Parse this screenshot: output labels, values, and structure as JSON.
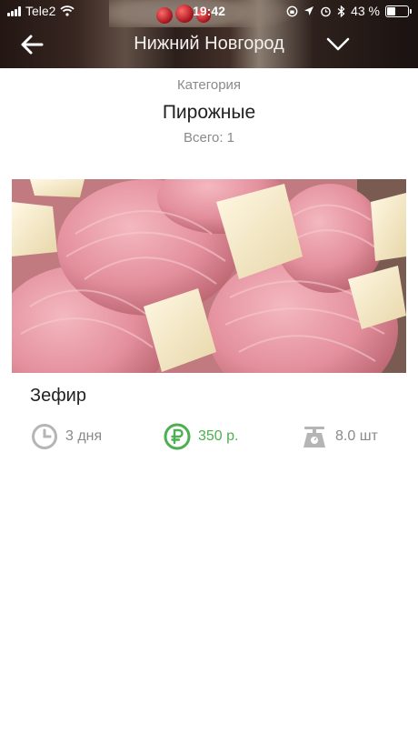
{
  "status_bar": {
    "carrier": "Tele2",
    "time": "19:42",
    "battery": "43 %",
    "battery_level": 0.43
  },
  "nav": {
    "title": "Нижний Новгород",
    "back_icon": "arrow-left-icon",
    "dropdown_icon": "chevron-down-icon"
  },
  "category": {
    "label": "Категория",
    "name": "Пирожные",
    "total": "Всего: 1"
  },
  "product": {
    "name": "Зефир",
    "shelf_life": "3 дня",
    "price": "350 р.",
    "quantity": "8.0 шт",
    "icons": [
      "clock-icon",
      "ruble-icon",
      "scale-icon"
    ]
  },
  "colors": {
    "price_green": "#4caf50",
    "muted_gray": "#8a8a8a",
    "icon_gray": "#b5b5b5"
  }
}
